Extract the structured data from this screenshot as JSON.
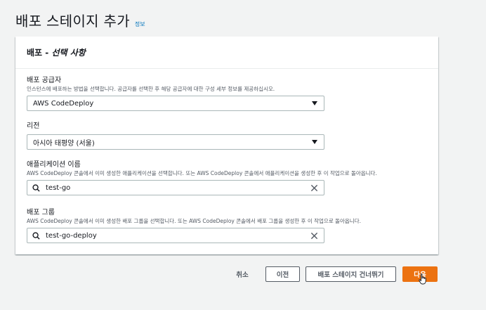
{
  "page": {
    "title": "배포 스테이지 추가",
    "info_link": "정보"
  },
  "panel": {
    "title_main": "배포",
    "title_sep": " - ",
    "title_optional": "선택 사항"
  },
  "fields": {
    "provider": {
      "label": "배포 공급자",
      "description": "인스턴스에 배포하는 방법을 선택합니다. 공급자를 선택한 후 해당 공급자에 대한 구성 세부 정보를 제공하십시오.",
      "value": "AWS CodeDeploy"
    },
    "region": {
      "label": "리전",
      "value": "아시아 태평양 (서울)"
    },
    "application": {
      "label": "애플리케이션 이름",
      "description": "AWS CodeDeploy 콘솔에서 이미 생성한 애플리케이션을 선택합니다. 또는 AWS CodeDeploy 콘솔에서 애플리케이션을 생성한 후 이 작업으로 돌아옵니다.",
      "value": "test-go"
    },
    "deployment_group": {
      "label": "배포 그룹",
      "description": "AWS CodeDeploy 콘솔에서 이미 생성한 배포 그룹을 선택합니다. 또는 AWS CodeDeploy 콘솔에서 배포 그룹을 생성한 후 이 작업으로 돌아옵니다.",
      "value": "test-go-deploy"
    }
  },
  "actions": {
    "cancel": "취소",
    "previous": "이전",
    "skip": "배포 스테이지 건너뛰기",
    "next": "다음"
  },
  "colors": {
    "primary": "#ec7211",
    "link": "#0073bb",
    "background": "#f2f3f3"
  },
  "icons": [
    "search-icon",
    "clear-icon",
    "caret-down-icon",
    "hand-cursor-icon"
  ]
}
